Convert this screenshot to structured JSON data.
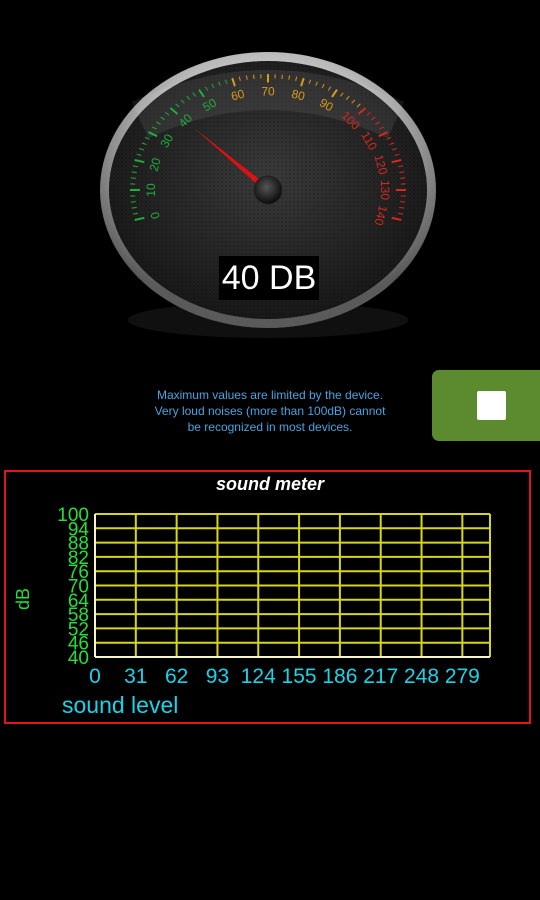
{
  "gauge": {
    "ticks": [
      "0",
      "10",
      "20",
      "30",
      "40",
      "50",
      "60",
      "70",
      "80",
      "90",
      "100",
      "110",
      "120",
      "130",
      "140"
    ],
    "reading_value": 40,
    "reading_label": "40 DB",
    "max_value": 140
  },
  "notice": {
    "line1": "Maximum values are limited by the device.",
    "line2": "Very loud noises (more than 100dB) cannot",
    "line3": "be recognized in most devices."
  },
  "stop_button": {
    "icon": "stop-icon"
  },
  "chart_data": {
    "type": "line",
    "title": "sound meter",
    "ylabel": "dB",
    "xlabel": "sound level",
    "ylim": [
      40,
      100
    ],
    "xlim": [
      0,
      300
    ],
    "y_ticks": [
      "100",
      "94",
      "88",
      "82",
      "76",
      "70",
      "64",
      "58",
      "52",
      "46",
      "40"
    ],
    "x_ticks": [
      "0",
      "31",
      "62",
      "93",
      "124",
      "155",
      "186",
      "217",
      "248",
      "279"
    ],
    "grid": true,
    "series": []
  },
  "colors": {
    "chart_border": "#e0161a",
    "grid": "#d6d61a",
    "y_text": "#22e03a",
    "x_text": "#19d4e8",
    "needle": "#e01010",
    "button": "#5c8a2e",
    "notice": "#4aa3e0"
  }
}
